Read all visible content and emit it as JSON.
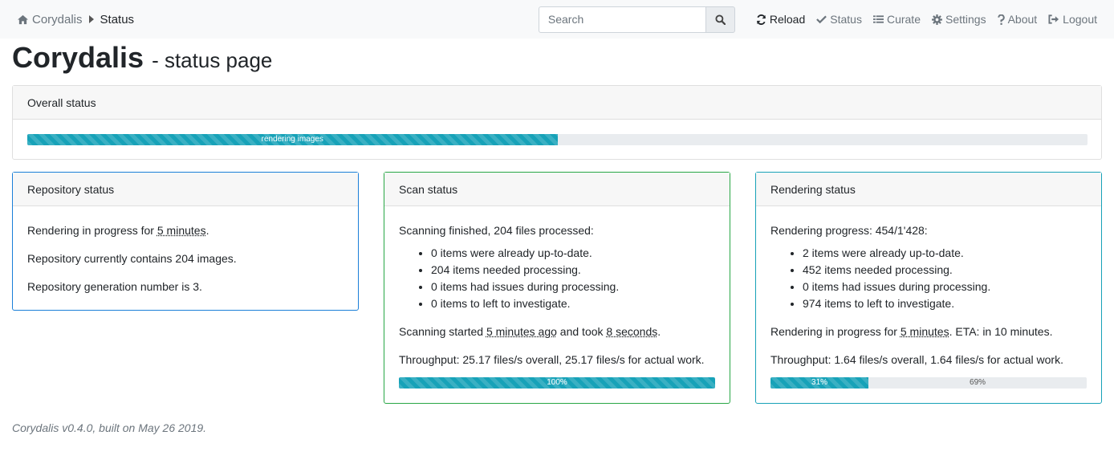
{
  "nav": {
    "brand": "Corydalis",
    "current": "Status",
    "search_placeholder": "Search",
    "links": [
      {
        "label": "Reload",
        "icon": "refresh-icon"
      },
      {
        "label": "Status",
        "icon": "check-icon"
      },
      {
        "label": "Curate",
        "icon": "list-icon"
      },
      {
        "label": "Settings",
        "icon": "gear-icon"
      },
      {
        "label": "About",
        "icon": "question-icon"
      },
      {
        "label": "Logout",
        "icon": "logout-icon"
      }
    ]
  },
  "page": {
    "title": "Corydalis",
    "subtitle": "- status page"
  },
  "overall": {
    "header": "Overall status",
    "bar_label": "rendering images",
    "progress_fraction": 0.5
  },
  "repository": {
    "header": "Repository status",
    "line1_pre": "Rendering in progress for ",
    "line1_time": "5 minutes",
    "line1_post": ".",
    "line2": "Repository currently contains 204 images.",
    "line3": "Repository generation number is 3."
  },
  "scan": {
    "header": "Scan status",
    "summary": "Scanning finished, 204 files processed:",
    "items": [
      "0 items were already up-to-date.",
      "204 items needed processing.",
      "0 items had issues during processing.",
      "0 items to left to investigate."
    ],
    "started_pre": "Scanning started ",
    "started_time": "5 minutes ago",
    "started_mid": " and took ",
    "started_duration": "8 seconds",
    "started_post": ".",
    "throughput": "Throughput: 25.17 files/s overall, 25.17 files/s for actual work.",
    "bar_label": "100%",
    "progress_percent": 100
  },
  "rendering": {
    "header": "Rendering status",
    "summary": "Rendering progress: 454/1'428:",
    "items": [
      "2 items were already up-to-date.",
      "452 items needed processing.",
      "0 items had issues during processing.",
      "974 items to left to investigate."
    ],
    "progress_pre": "Rendering in progress for ",
    "progress_time": "5 minutes",
    "progress_post": ". ETA: in 10 minutes.",
    "throughput": "Throughput: 1.64 files/s overall, 1.64 files/s for actual work.",
    "bar_done_label": "31%",
    "bar_rest_label": "69%",
    "done_percent": 31
  },
  "footer": {
    "text": "Corydalis v0.4.0, built on May 26 2019."
  },
  "colors": {
    "info": "#17a2b8",
    "success": "#28a745",
    "primary": "#1a7fd8"
  }
}
